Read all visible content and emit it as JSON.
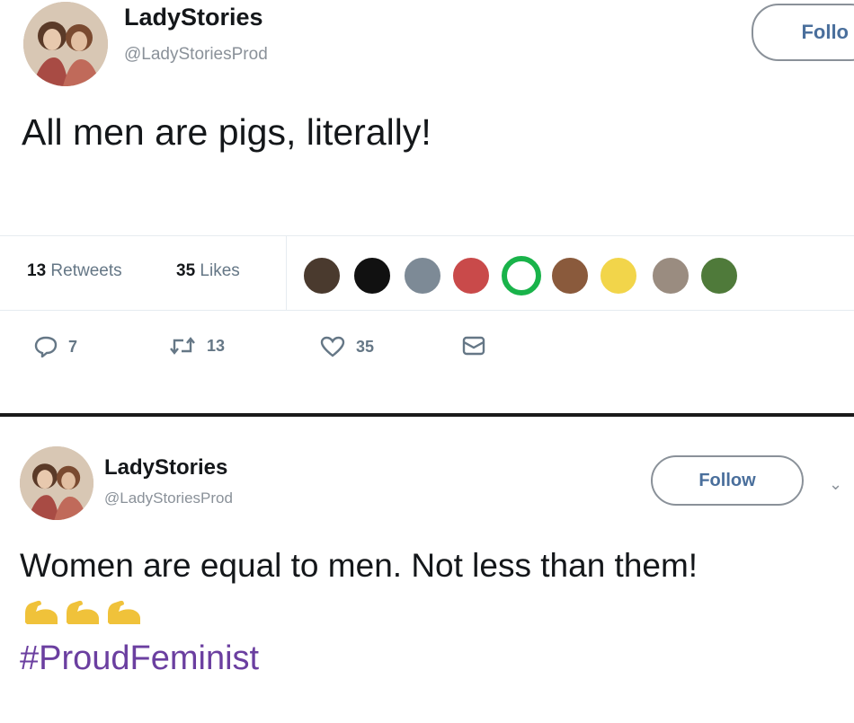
{
  "tweet1": {
    "display_name": "LadyStories",
    "handle": "@LadyStoriesProd",
    "follow_label": "Follo",
    "text": "All men are pigs, literally!",
    "stats": {
      "retweets_count": "13",
      "retweets_label": "Retweets",
      "likes_count": "35",
      "likes_label": "Likes"
    },
    "likers": [
      {
        "icon": "liker-avatar-1",
        "color": "#4a3a2e"
      },
      {
        "icon": "liker-avatar-2",
        "color": "#111111"
      },
      {
        "icon": "liker-avatar-3",
        "color": "#7d8a96"
      },
      {
        "icon": "liker-avatar-4",
        "color": "#c94a4a"
      },
      {
        "icon": "liker-avatar-5",
        "color": "#19b34a"
      },
      {
        "icon": "liker-avatar-6",
        "color": "#8a5a3c"
      },
      {
        "icon": "liker-avatar-7",
        "color": "#f2d54a"
      },
      {
        "icon": "liker-avatar-8",
        "color": "#9a8c80"
      },
      {
        "icon": "liker-avatar-9",
        "color": "#4f7a3a"
      }
    ],
    "actions": {
      "reply_count": "7",
      "retweet_count": "13",
      "like_count": "35"
    }
  },
  "tweet2": {
    "display_name": "LadyStories",
    "handle": "@LadyStoriesProd",
    "follow_label": "Follow",
    "text": "Women are equal to men. Not less than them!",
    "emoji": [
      "flexed-biceps-icon",
      "flexed-biceps-icon",
      "flexed-biceps-icon"
    ],
    "hashtag": "#ProudFeminist"
  },
  "colors": {
    "follow_text": "#4a6f9c",
    "hashtag": "#6b3fa0",
    "muted": "#657786",
    "divider": "#1a1a1a"
  }
}
